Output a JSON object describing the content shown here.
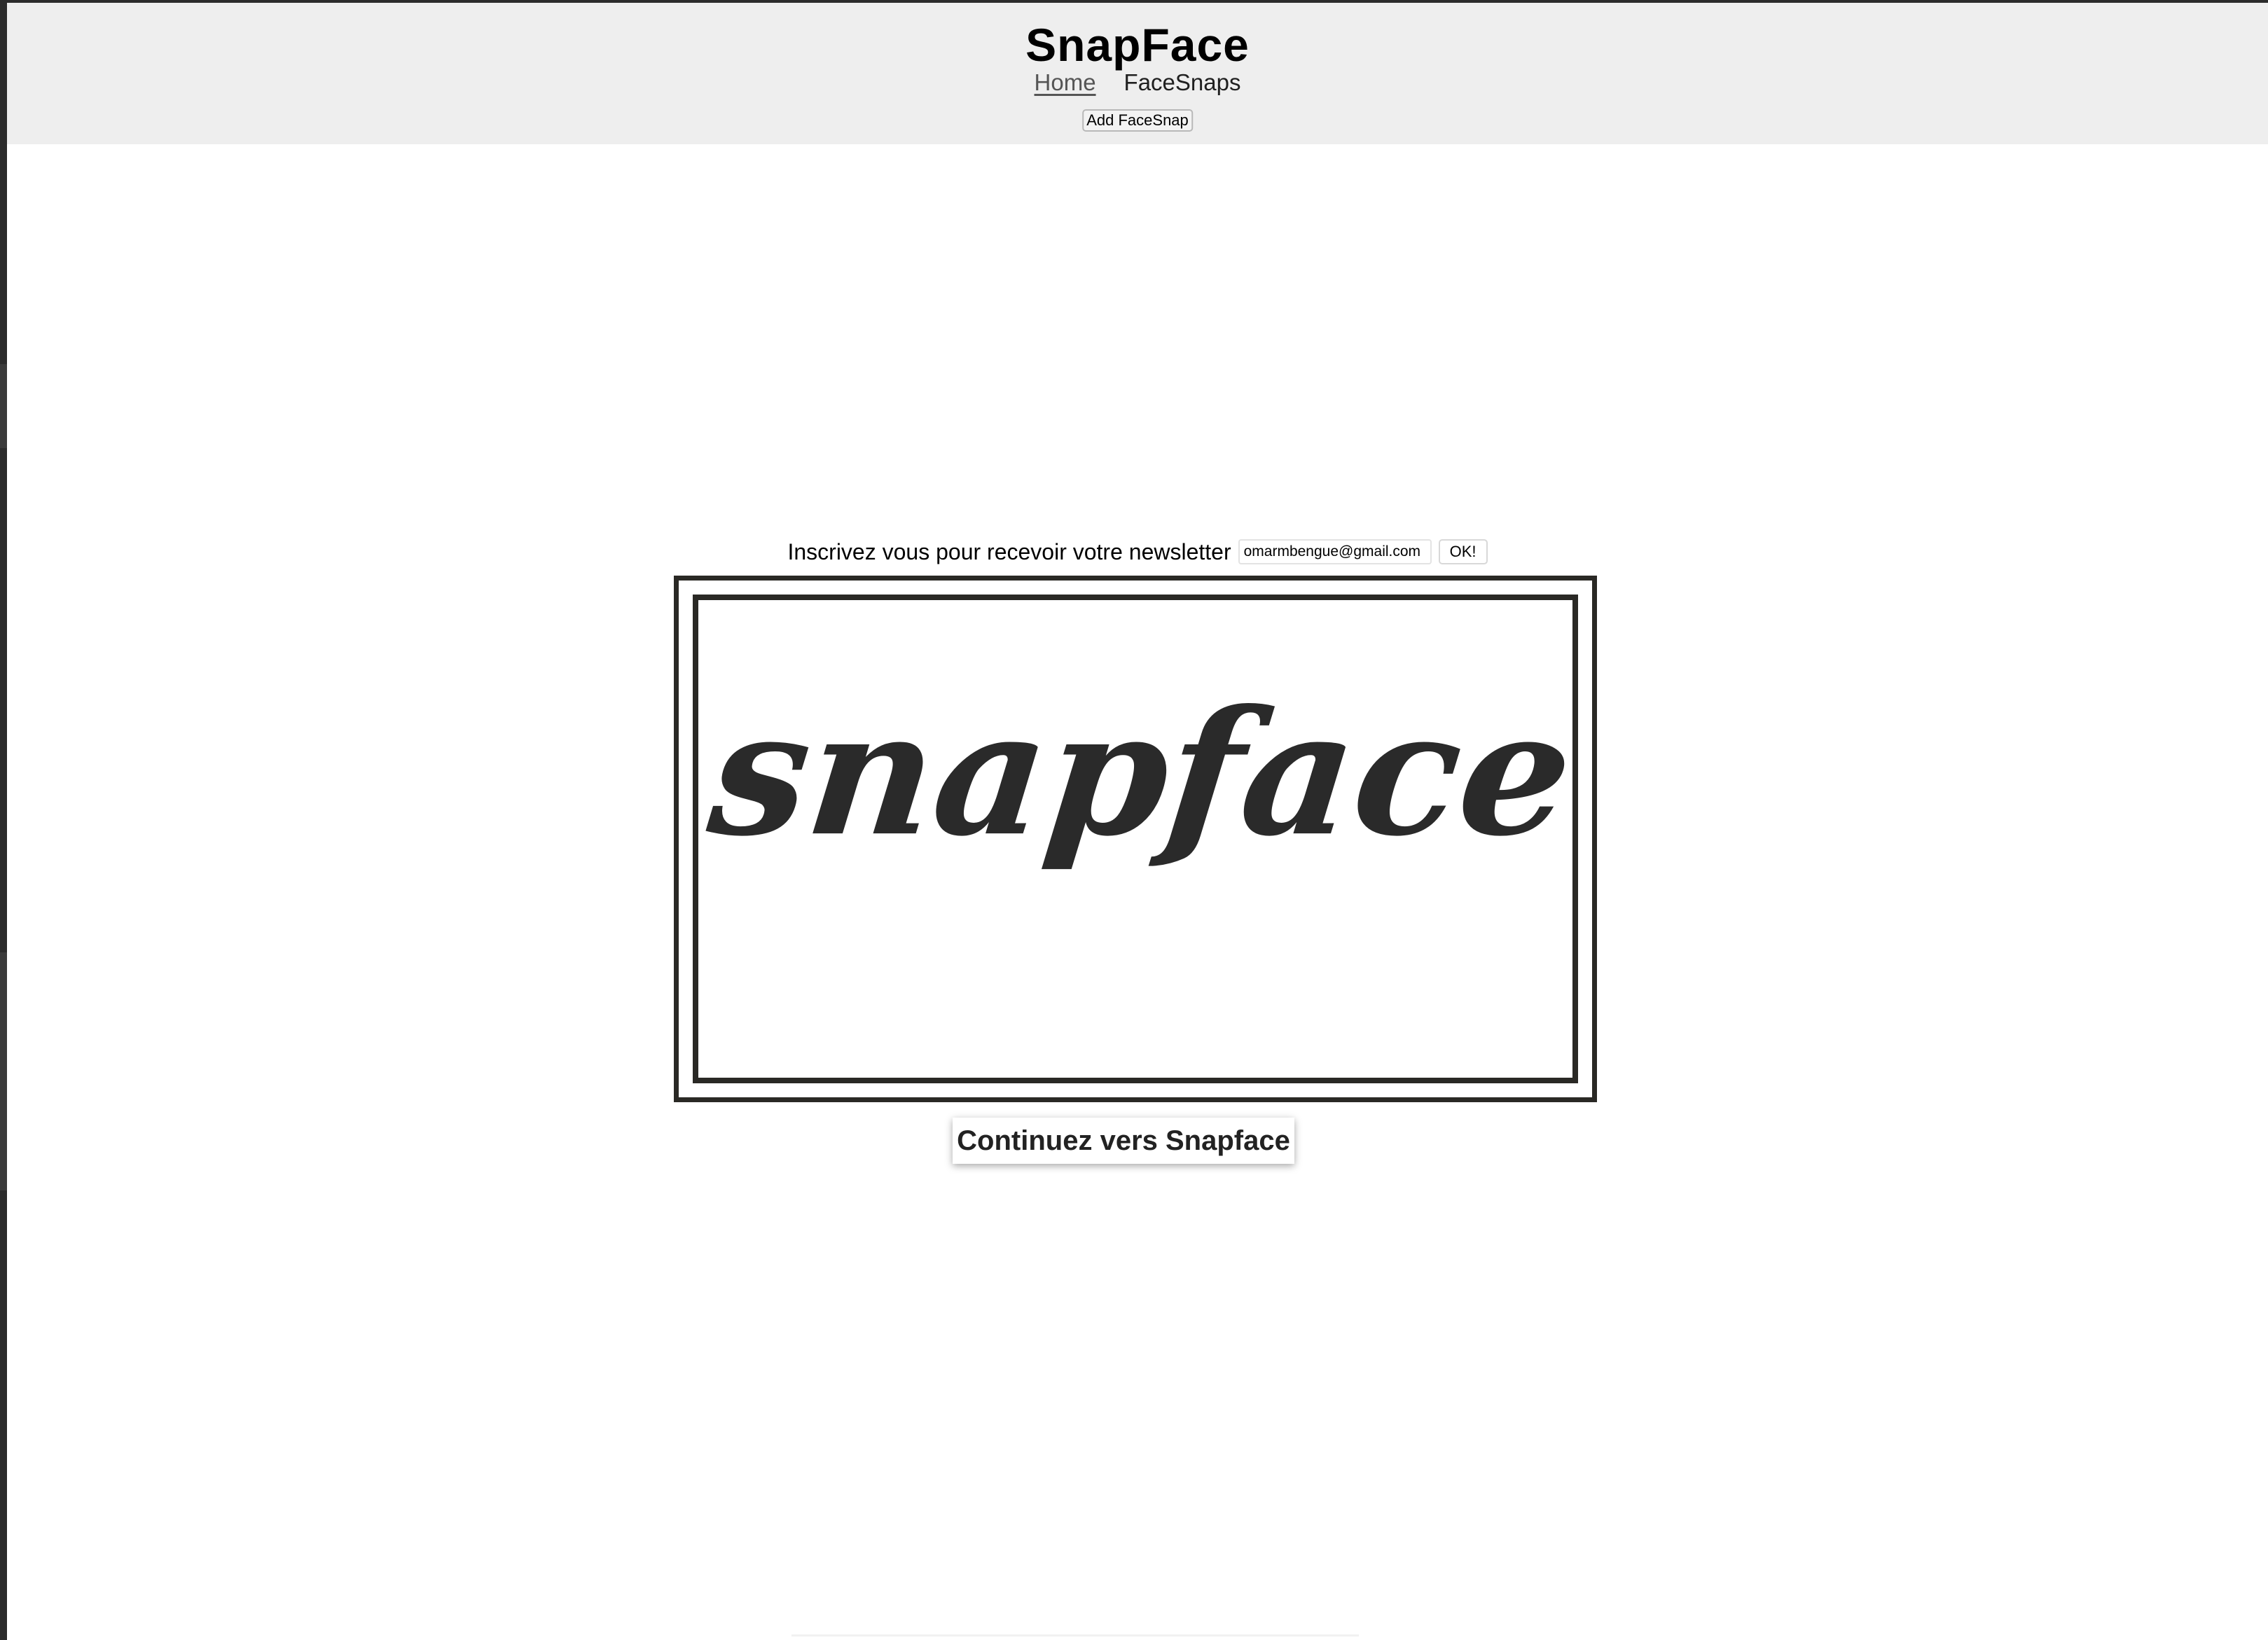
{
  "header": {
    "title": "SnapFace",
    "nav": {
      "home": "Home",
      "facesnaps": "FaceSnaps"
    },
    "add_button": "Add FaceSnap"
  },
  "newsletter": {
    "label": "Inscrivez vous pour recevoir votre newsletter",
    "email_value": "omarmbengue@gmail.com",
    "submit_label": "OK!"
  },
  "logo": {
    "text": "snapface",
    "frame_color": "#2a2925"
  },
  "continue_button": "Continuez vers Snapface",
  "colors": {
    "header_bg": "#eeeeee",
    "page_bg": "#ffffff",
    "window_bg": "#2b2b2b"
  }
}
